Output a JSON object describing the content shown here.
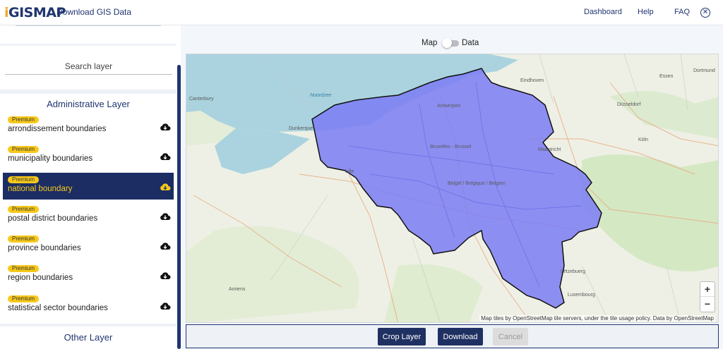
{
  "header": {
    "logo_text": "GISMAP",
    "logo_i": "i",
    "title": "Download GIS Data",
    "nav": [
      "Dashboard",
      "Help",
      "FAQ"
    ],
    "close_glyph": "✕"
  },
  "sidebar": {
    "search_placeholder": "Search layer",
    "section_title": "Administrative Layer",
    "other_section": "Other Layer",
    "badge": "Premium",
    "layers": [
      {
        "label": "arrondissement boundaries"
      },
      {
        "label": "municipality boundaries"
      },
      {
        "label": "national boundary",
        "selected": true
      },
      {
        "label": "postal district boundaries"
      },
      {
        "label": "province boundaries"
      },
      {
        "label": "region boundaries"
      },
      {
        "label": "statistical sector boundaries"
      }
    ],
    "download_icon": "cloud-download-icon"
  },
  "main": {
    "toggle": {
      "left": "Map",
      "right": "Data",
      "mode": "Map"
    },
    "map": {
      "zoom_in": "+",
      "zoom_out": "−",
      "attribution": "Map tiles by OpenStreetMap tile servers, under the tile usage policy. Data by OpenStreetMap",
      "labels": {
        "north_sea": "Noordzee",
        "antwerpen": "Antwerpen",
        "bruxelles": "Bruxelles - Brussel",
        "belgique": "België / Belgique / Belgien",
        "luxembourg": "Luxembourg",
        "letzebuerg": "Lëtzebuerg",
        "dusseldorf": "Düsseldorf",
        "essen": "Essen",
        "dortmund": "Dortmund",
        "koln": "Köln",
        "lille": "Lille",
        "dunkerque": "Dunkerque",
        "canterbury": "Canterbury",
        "eindhoven": "Eindhoven",
        "maastricht": "Maastricht",
        "amiens": "Amiens"
      }
    },
    "buttons": {
      "crop": "Crop Layer",
      "download": "Download",
      "cancel": "Cancel"
    }
  },
  "colors": {
    "brand": "#203570",
    "accent": "#f7c91c",
    "selected_row": "#1b2d63",
    "boundary_fill": "#7b7cf5"
  }
}
